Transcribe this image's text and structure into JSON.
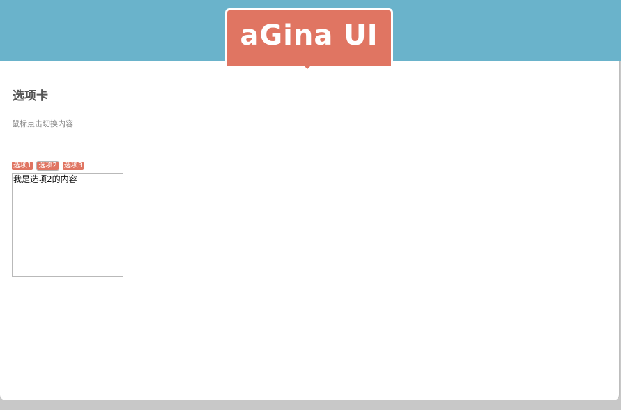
{
  "header": {
    "logo_text": "aGina UI"
  },
  "section": {
    "title": "选项卡",
    "description": "鼠标点击切换内容"
  },
  "tabs": [
    {
      "label": "选项1"
    },
    {
      "label": "选项2"
    },
    {
      "label": "选项3"
    }
  ],
  "active_tab_index": 1,
  "panel": {
    "content": "我是选项2的内容"
  },
  "colors": {
    "header_band": "#6ab3cb",
    "logo_background": "#e07562",
    "tab_background": "#e07562",
    "content_background": "#ffffff"
  }
}
